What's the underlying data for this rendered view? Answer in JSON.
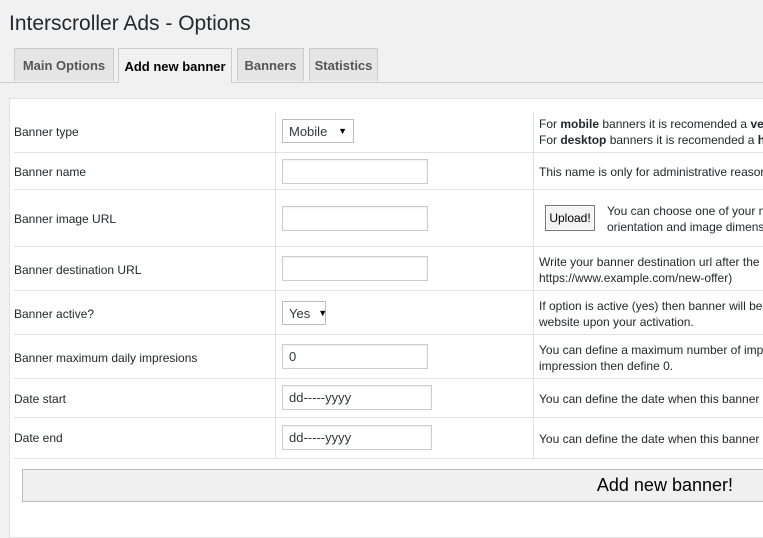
{
  "page": {
    "title": "Interscroller Ads - Options"
  },
  "tabs": [
    {
      "label": "Main Options"
    },
    {
      "label": "Add new banner"
    },
    {
      "label": "Banners"
    },
    {
      "label": "Statistics"
    }
  ],
  "form": {
    "banner_type": {
      "label": "Banner type",
      "value": "Mobile",
      "help_mobile_pre": "For ",
      "help_mobile_bold": "mobile",
      "help_mobile_post": " banners it is recomended a ",
      "help_mobile_tail": "verti",
      "help_desktop_pre": "For ",
      "help_desktop_bold": "desktop",
      "help_desktop_post": " banners it is recomended a ",
      "help_desktop_tail": "hor"
    },
    "banner_name": {
      "label": "Banner name",
      "value": "",
      "help": "This name is only for administrative reasons"
    },
    "banner_image_url": {
      "label": "Banner image URL",
      "value": "",
      "upload_label": "Upload!",
      "help_line1": "You can choose one of your m",
      "help_line2": "orientation and image dimens"
    },
    "banner_destination_url": {
      "label": "Banner destination URL",
      "value": "",
      "help_line1": "Write your banner destination url after the v",
      "help_line2": "https://www.example.com/new-offer)"
    },
    "banner_active": {
      "label": "Banner active?",
      "value": "Yes",
      "help_line1": "If option is active (yes) then banner will be d",
      "help_line2": "website upon your activation."
    },
    "banner_max_daily": {
      "label": "Banner maximum daily impresions",
      "value": "0",
      "help_line1": "You can define a maximum number of impre",
      "help_line2": "impression then define 0."
    },
    "date_start": {
      "label": "Date start",
      "value": "dd-----yyyy",
      "help": "You can define the date when this banner S"
    },
    "date_end": {
      "label": "Date end",
      "value": "dd-----yyyy",
      "help": "You can define the date when this banner S"
    },
    "submit_label": "Add new banner!"
  }
}
